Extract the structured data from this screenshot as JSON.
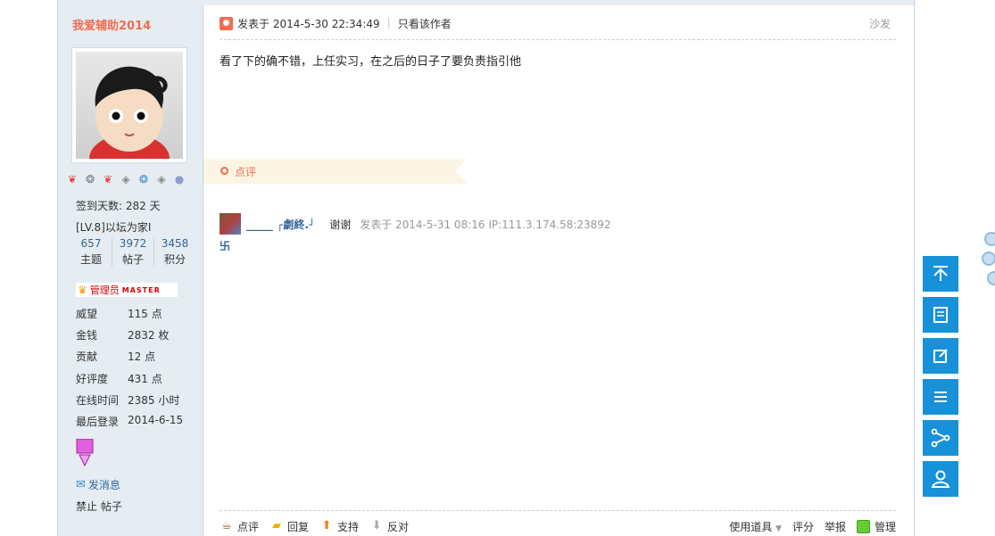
{
  "user": {
    "name": "我爱辅助2014",
    "checkin": "签到天数: 282 天",
    "level": "[LV.8]以坛为家I",
    "stats": [
      {
        "num": "657",
        "label": "主题"
      },
      {
        "num": "3972",
        "label": "帖子"
      },
      {
        "num": "3458",
        "label": "积分"
      }
    ],
    "role": "管理员",
    "role_badge": "MASTER",
    "fields": [
      {
        "k": "威望",
        "v": "115 点"
      },
      {
        "k": "金钱",
        "v": "2832 枚"
      },
      {
        "k": "贡献",
        "v": "12 点"
      },
      {
        "k": "好评度",
        "v": "431 点"
      },
      {
        "k": "在线时间",
        "v": "2385 小时"
      },
      {
        "k": "最后登录",
        "v": "2014-6-15"
      }
    ],
    "send_message": "发消息",
    "ban_posts": "禁止 帖子"
  },
  "post": {
    "date": "发表于 2014-5-30 22:34:49",
    "only_author": "只看该作者",
    "floor": "沙发",
    "content": "看了下的确不错，上任实习，在之后的日子了要负责指引他",
    "comment_section": "点评"
  },
  "comment": {
    "user": "_____ ┌劇終.┘",
    "thanks": "谢谢",
    "date": "发表于 2014-5-31 08:16 IP:111.3.174.58:23892",
    "text": "卐"
  },
  "footer": {
    "rate": "点评",
    "reply": "回复",
    "support": "支持",
    "oppose": "反对",
    "tools": "使用道具",
    "score": "评分",
    "report": "举报",
    "manage": "管理"
  },
  "colors": {
    "accent": "#1791d8",
    "username": "#f26c4f",
    "link": "#336699",
    "sidebar_bg": "#e5edf2"
  }
}
